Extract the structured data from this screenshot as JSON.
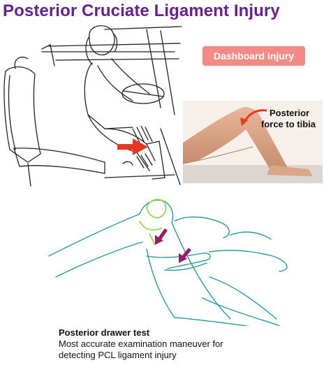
{
  "title": "Posterior Cruciate Ligament Injury",
  "badge": {
    "label": "Dashboard injury",
    "color": "#f48a85"
  },
  "photo_label": {
    "line1": "Posterior",
    "line2": "force to tibia"
  },
  "caption": {
    "heading": "Posterior drawer test",
    "line1": "Most accurate examination maneuver for",
    "line2": "detecting PCL ligament injury"
  },
  "colors": {
    "title": "#6a1f8f",
    "arrow_red": "#e8371f",
    "arrow_purple": "#9a1a6a",
    "outline_teal": "#2a9a9a",
    "ligament_green": "#8cd23a"
  }
}
